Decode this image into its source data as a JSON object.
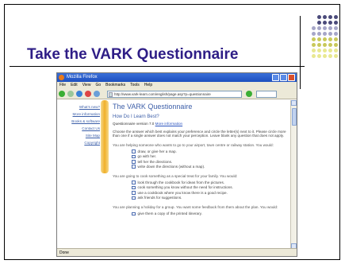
{
  "slide": {
    "title": "Take the VARK Questionnaire",
    "decor_dot_colors": [
      "#4a4a7a",
      "#a6a6c8",
      "#c9c95a",
      "#e8e890"
    ]
  },
  "browser": {
    "window_title": "Mozilla Firefox",
    "menu": [
      "File",
      "Edit",
      "View",
      "Go",
      "Bookmarks",
      "Tools",
      "Help"
    ],
    "url": "http://www.vark-learn.com/english/page.asp?p=questionnaire",
    "status": "Done"
  },
  "page": {
    "sidenav": [
      "What's new?",
      "More information",
      "Books & software",
      "Contact Us",
      "Site Map",
      "Copyright"
    ],
    "heading": "The VARK Questionnaire",
    "subheading": "How Do I Learn Best?",
    "version_label": "Questionnaire version 7.0",
    "more_info_link": "More information",
    "intro": "Choose the answer which best explains your preference and circle the letter(s) next to it. Please circle more than one if a single answer does not match your perception. Leave blank any question that does not apply.",
    "questions": [
      {
        "text": "You are helping someone who wants to go to your airport, town centre or railway station. You would:",
        "options": [
          "draw, or give her a map.",
          "go with her.",
          "tell her the directions.",
          "write down the directions (without a map)."
        ]
      },
      {
        "text": "You are going to cook something as a special treat for your family. You would:",
        "options": [
          "look through the cookbook for ideas from the pictures.",
          "cook something you know without the need for instructions.",
          "use a cookbook where you know there is a good recipe.",
          "ask friends for suggestions."
        ]
      },
      {
        "text": "You are planning a holiday for a group. You want some feedback from them about the plan. You would:",
        "options": [
          "give them a copy of the printed itinerary."
        ]
      }
    ]
  }
}
